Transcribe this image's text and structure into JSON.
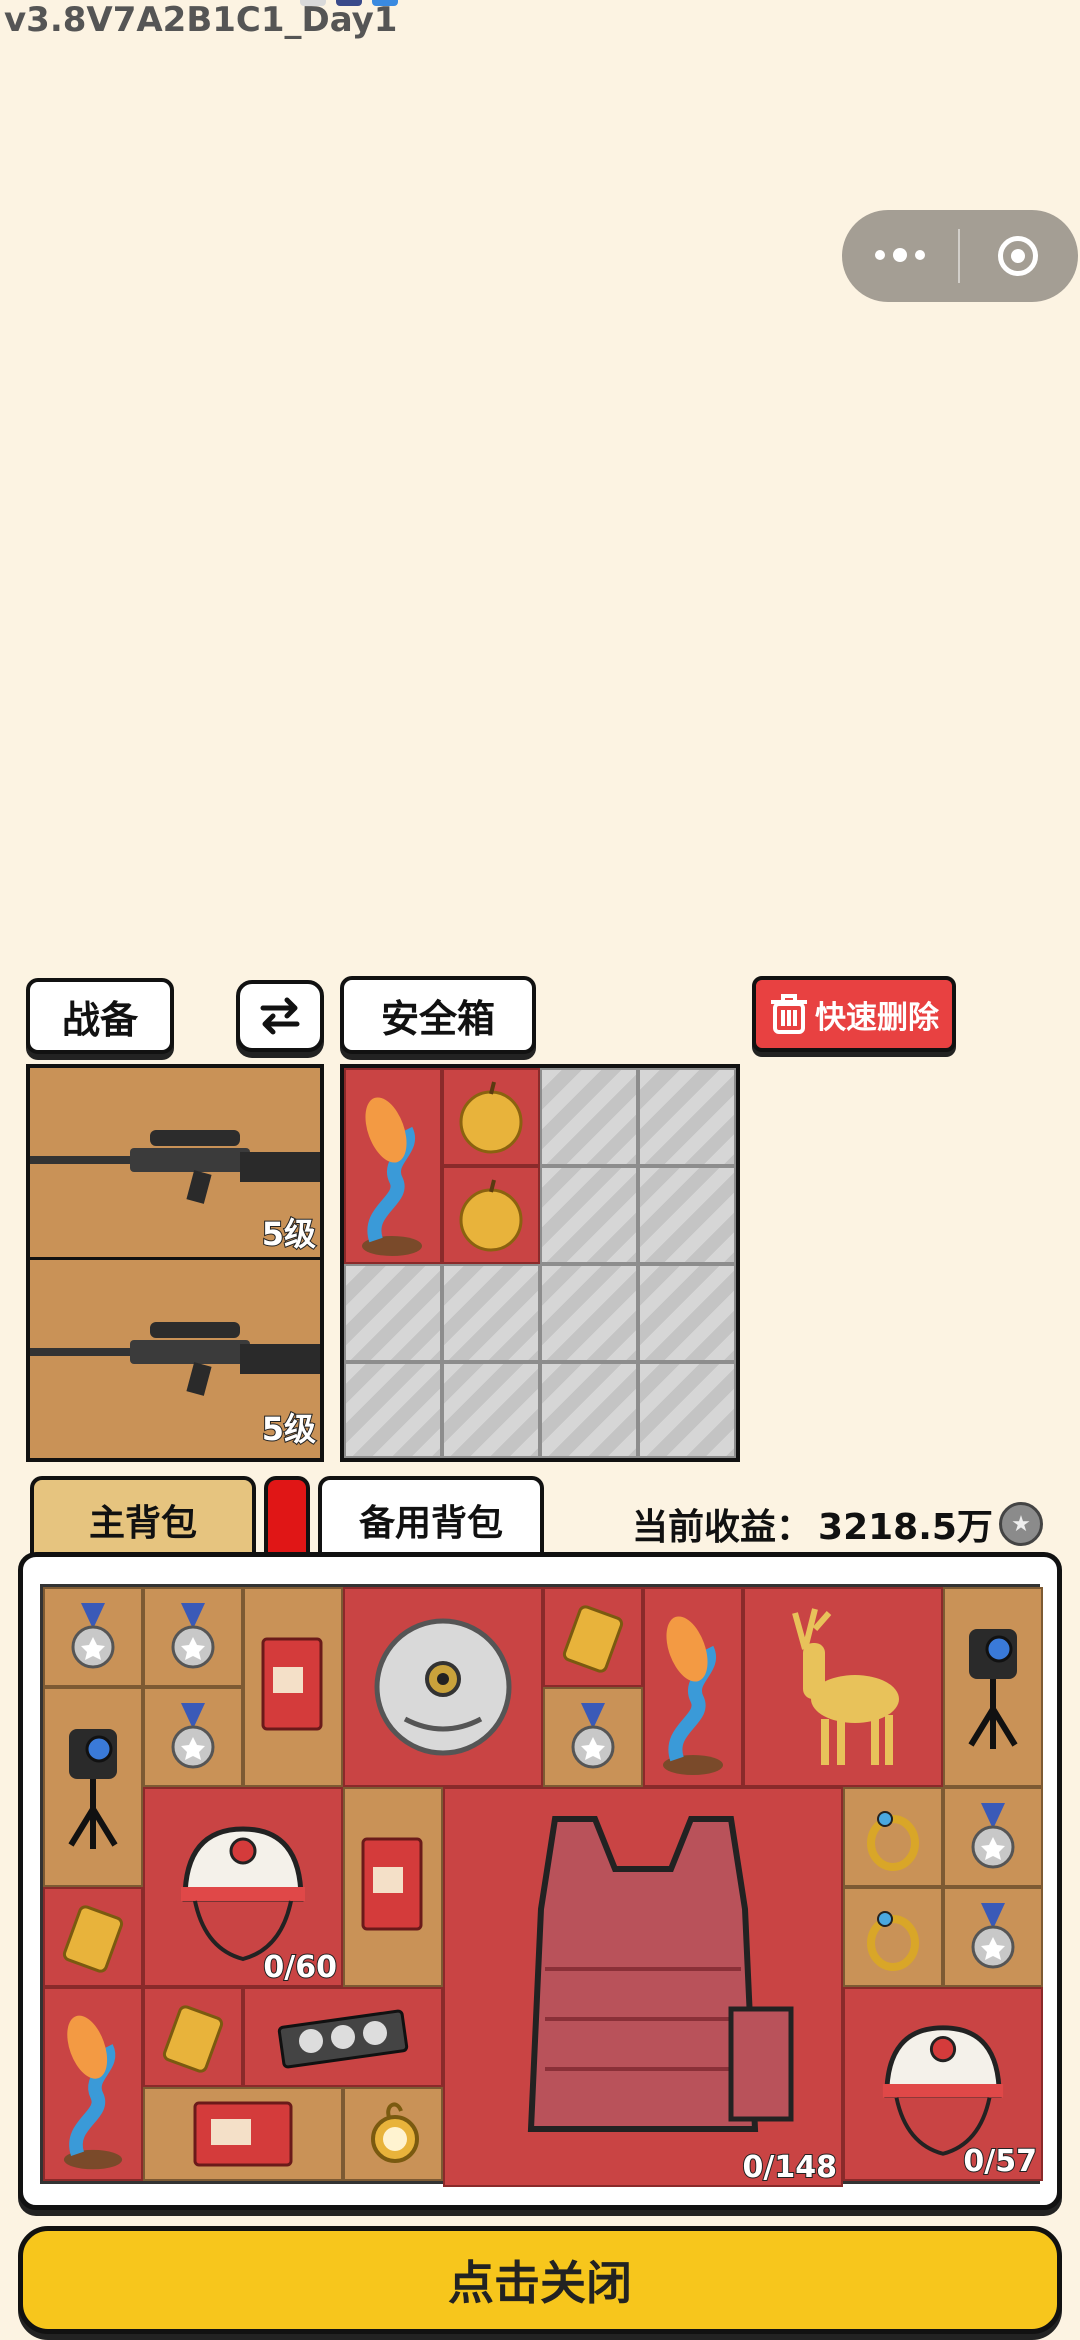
{
  "version": "v3.8V7A2B1C1_Day1",
  "capsule": {
    "more_icon": "more-dots-icon",
    "close_icon": "target-circle-icon"
  },
  "equipment": {
    "tab_label": "战备",
    "swap_icon": "swap-arrows-icon",
    "safe_label": "安全箱",
    "delete_label": "快速删除",
    "weapons": [
      {
        "name": "sniper-rifle",
        "level": "5级"
      },
      {
        "name": "sniper-rifle",
        "level": "5级"
      }
    ]
  },
  "safebox": {
    "items": [
      "koi-fish-statue",
      "golden-apple",
      "golden-apple"
    ]
  },
  "bag": {
    "tabs": {
      "main": "主背包",
      "backup": "备用背包"
    },
    "earnings_label": "当前收益：",
    "earnings_value": "3218.5万",
    "coin_icon": "coin-icon",
    "counts": {
      "helmet1": "0/60",
      "vest": "0/148",
      "helmet2": "0/57"
    },
    "items": [
      "medal",
      "medal",
      "coffee-box",
      "silver-mask",
      "gold-bar",
      "koi-fish-statue",
      "golden-deer",
      "action-camera",
      "action-camera",
      "medal",
      "medal",
      "helmet",
      "coffee-box",
      "body-armor",
      "gold-ring",
      "medal",
      "gold-ring",
      "medal",
      "gold-bar",
      "koi-fish-statue",
      "gold-bar",
      "gpu-card",
      "coffee-box",
      "gold-pocket-watch",
      "helmet"
    ]
  },
  "close_label": "点击关闭"
}
